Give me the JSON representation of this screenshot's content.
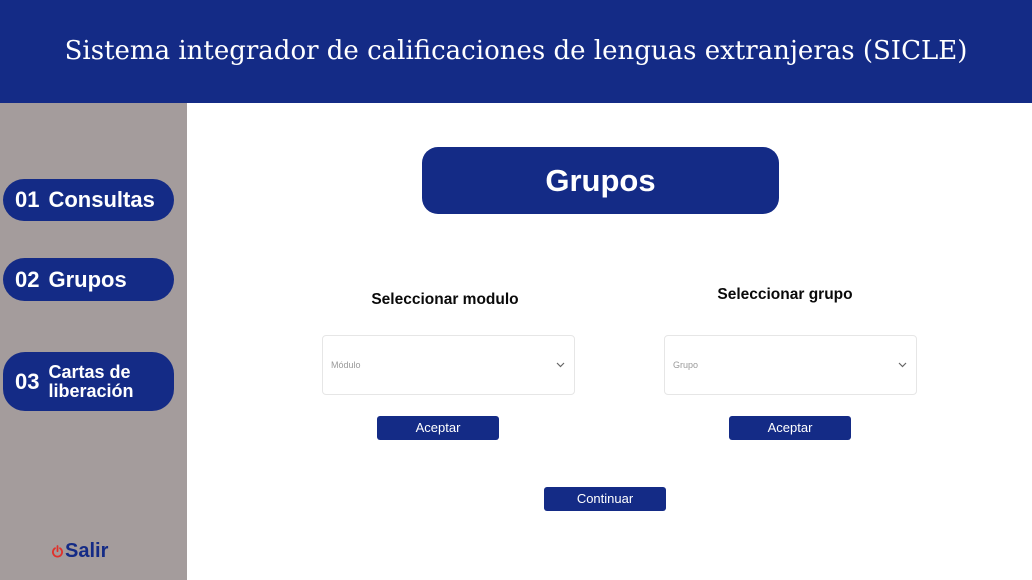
{
  "header": {
    "title": "Sistema integrador de calificaciones de lenguas extranjeras (SICLE)"
  },
  "sidebar": {
    "items": [
      {
        "number": "01",
        "label": "Consultas"
      },
      {
        "number": "02",
        "label": "Grupos"
      },
      {
        "number": "03",
        "label_line1": "Cartas de",
        "label_line2": "liberación"
      }
    ],
    "exit": {
      "label": "Salir",
      "icon": "power-icon"
    }
  },
  "main": {
    "title": "Grupos",
    "module_column": {
      "label": "Seleccionar modulo",
      "select_value": "Módulo",
      "button_label": "Aceptar"
    },
    "group_column": {
      "label": "Seleccionar grupo",
      "select_value": "Grupo",
      "button_label": "Aceptar"
    },
    "continue_label": "Continuar"
  },
  "colors": {
    "brand": "#142b86",
    "sidebar": "#a49c9c",
    "exit_icon": "#e0312b",
    "background": "#ffffff"
  }
}
